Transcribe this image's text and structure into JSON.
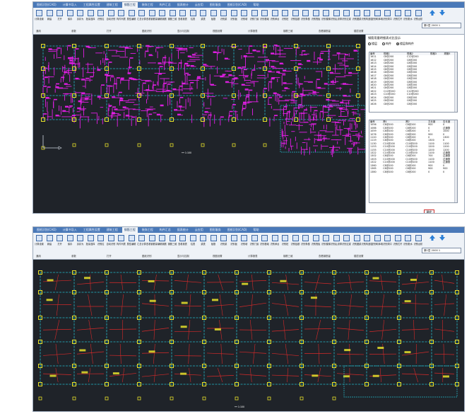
{
  "screenshot_top": {
    "tabs": [
      "图纸识别(CAD)",
      "计算书导入",
      "工程属性设置",
      "建筑工程",
      "钢筋工程",
      "装饰工程",
      "构件汇总",
      "报表统计",
      "云应用",
      "图形服务",
      "图纸识别(CAD)",
      "帮助"
    ],
    "active_tab_index": 4,
    "ribbon_tools": [
      "计算设置",
      "新建",
      "打开",
      "保存",
      "另存为",
      "批量选择",
      "识别柱",
      "自动识别",
      "构件列表",
      "属性编辑",
      "汇总计算",
      "查看钢筋量",
      "编辑钢筋",
      "钢筋三维",
      "查看报表",
      "柱表",
      "梁表",
      "板筋",
      "识别梁",
      "识别板",
      "识别墙",
      "识别门窗",
      "识别基础",
      "识别承台",
      "识别桩",
      "识别独基",
      "识别条基",
      "识别筏板",
      "识别楼梯",
      "识别后浇带",
      "识别过梁",
      "识别圈梁",
      "识别构造柱",
      "识别砌体墙",
      "识别洞口",
      "识别栏杆",
      "识别散水",
      "识别台阶"
    ],
    "ribbon_groups": [
      "通用",
      "参数",
      "打开",
      "图纸识别",
      "显示与控制",
      "视图设置",
      "计算报表",
      "钢筋三维",
      "查看钢筋量",
      "楼层设置"
    ],
    "floor_select": "第1层  2000  1",
    "panel": {
      "title": "钢筋用量明细表对比显示",
      "radios": [
        "楼层",
        "构件",
        "楼层和构件"
      ],
      "selected_radio_index": 2,
      "table1_headers": [
        "编号",
        "规格1",
        "规格2",
        "规格3",
        "规格5"
      ],
      "table1_rows": [
        [
          "1611",
          "C8@200",
          "C12@200",
          "",
          ""
        ],
        [
          "1612",
          "C8@200",
          "C8@200",
          "",
          ""
        ],
        [
          "1613",
          "C8@200",
          "C8@200",
          "",
          ""
        ],
        [
          "1614",
          "C8@200",
          "C8@200",
          "",
          ""
        ],
        [
          "1615",
          "C8@200",
          "C8@200",
          "",
          ""
        ],
        [
          "1616",
          "C8@200",
          "C8@200",
          "",
          ""
        ],
        [
          "1617",
          "C8@200",
          "C8@200",
          "",
          ""
        ],
        [
          "1618",
          "C8@200",
          "C8@200",
          "",
          ""
        ],
        [
          "1619",
          "C8@200",
          "C8@200",
          "",
          ""
        ],
        [
          "1620",
          "C8@200",
          "C8@200",
          "",
          ""
        ],
        [
          "1621",
          "C8@200",
          "C8@200",
          "",
          ""
        ],
        [
          "1622",
          "C12@200",
          "C12@200",
          "",
          ""
        ],
        [
          "1623",
          "C10@200",
          "C10@200",
          "",
          ""
        ],
        [
          "1624",
          "C8@200",
          "C8@200",
          "",
          ""
        ],
        [
          "1625",
          "C8@200",
          "C8@200",
          "",
          ""
        ],
        [
          "1626",
          "C8@200",
          "C8@200",
          "",
          ""
        ]
      ],
      "table2_headers": [
        "编号",
        "跨1",
        "跨2",
        "左长度",
        "右长度"
      ],
      "table2_rows": [
        [
          "1056",
          "C8@200",
          "C8@200",
          "900",
          "0"
        ],
        [
          "1066",
          "C8@200",
          "C8@200",
          "0",
          "过通筋"
        ],
        [
          "1059",
          "C8@200",
          "C8@200",
          "0",
          "1000"
        ],
        [
          "1076",
          "C8@200",
          "C8@200",
          "900",
          "0"
        ],
        [
          "1120",
          "C8@200",
          "C8@200",
          "0",
          "1300"
        ],
        [
          "1119",
          "C8@200",
          "C8@200",
          "1300",
          "0"
        ],
        [
          "1130",
          "C10@200",
          "C10@200",
          "1100",
          "1100"
        ],
        [
          "1153",
          "C10@200",
          "C10@200",
          "1200",
          "1200"
        ],
        [
          "1155",
          "C10@200",
          "C10@200",
          "1200",
          "1200"
        ],
        [
          "1322",
          "C10@200",
          "C10@200",
          "1100",
          "过通筋"
        ],
        [
          "1302",
          "C8@200",
          "C8@200",
          "700",
          "过通筋"
        ],
        [
          "1303",
          "C10@200",
          "C10@200",
          "1100",
          "过通筋"
        ],
        [
          "1322",
          "C10@200",
          "C10@200",
          "1100",
          "过通筋"
        ],
        [
          "1360",
          "C8@200",
          "C8@200",
          "900",
          "0"
        ],
        [
          "1365",
          "C8@200",
          "C8@200",
          "900",
          "900"
        ],
        [
          "1380",
          "C8@200",
          "C8@200",
          "0",
          "0"
        ]
      ],
      "ok_label": "确定"
    }
  },
  "screenshot_bottom": {
    "tabs": [
      "图纸识别(CAD)",
      "计算书导入",
      "工程属性设置",
      "建筑工程",
      "钢筋工程",
      "装饰工程",
      "构件汇总",
      "报表统计",
      "云应用",
      "图形服务",
      "图纸识别(CAD)",
      "帮助"
    ],
    "active_tab_index": 4,
    "ribbon_groups": [
      "通用",
      "参数",
      "打开",
      "图纸识别",
      "显示与控制",
      "视图设置",
      "计算报表",
      "钢筋三维",
      "查看钢筋量",
      "楼层设置"
    ],
    "floor_select": "第1层  2000  1"
  },
  "colors": {
    "canvas_bg": "#1f2329",
    "axis_grid": "#25b9c9",
    "column_marker": "#e8e22a",
    "slab_rebar_magenta": "#e21ee5",
    "beam_red": "#d62a2a",
    "tab_bar": "#4a79b8",
    "ok_border": "#d23434"
  }
}
